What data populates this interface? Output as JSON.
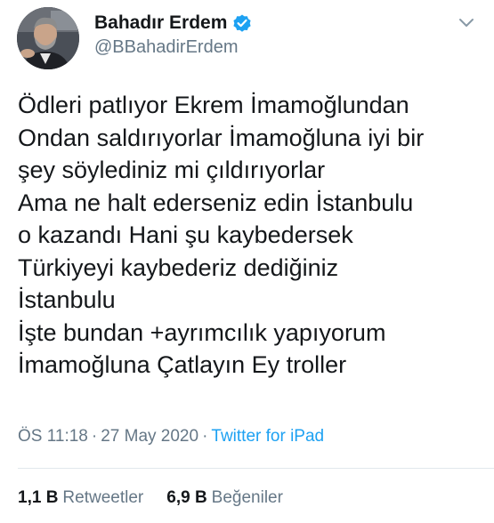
{
  "user": {
    "display_name": "Bahadır Erdem",
    "handle": "@BBahadirErdem",
    "verified": true
  },
  "tweet": {
    "lines": [
      "Ödleri patlıyor Ekrem İmamoğlundan",
      "Ondan saldırıyorlar İmamoğluna iyi bir",
      "şey söylediniz mi çıldırıyorlar",
      "Ama ne halt ederseniz edin İstanbulu",
      "o kazandı Hani şu kaybedersek",
      "Türkiyeyi kaybederiz dediğiniz",
      "İstanbulu",
      "İşte bundan +ayrımcılık yapıyorum",
      "İmamoğluna Çatlayın Ey troller"
    ]
  },
  "meta": {
    "time": "ÖS 11:18",
    "separator": "·",
    "date": "27 May 2020",
    "source": "Twitter for iPad"
  },
  "stats": {
    "retweets_count": "1,1 B",
    "retweets_label": "Retweetler",
    "likes_count": "6,9 B",
    "likes_label": "Beğeniler"
  },
  "icons": {
    "verified": "verified-badge-icon",
    "menu": "chevron-down-icon"
  },
  "colors": {
    "accent": "#1da1f2",
    "text": "#14171a",
    "secondary": "#657786",
    "divider": "#e1e8ed"
  }
}
